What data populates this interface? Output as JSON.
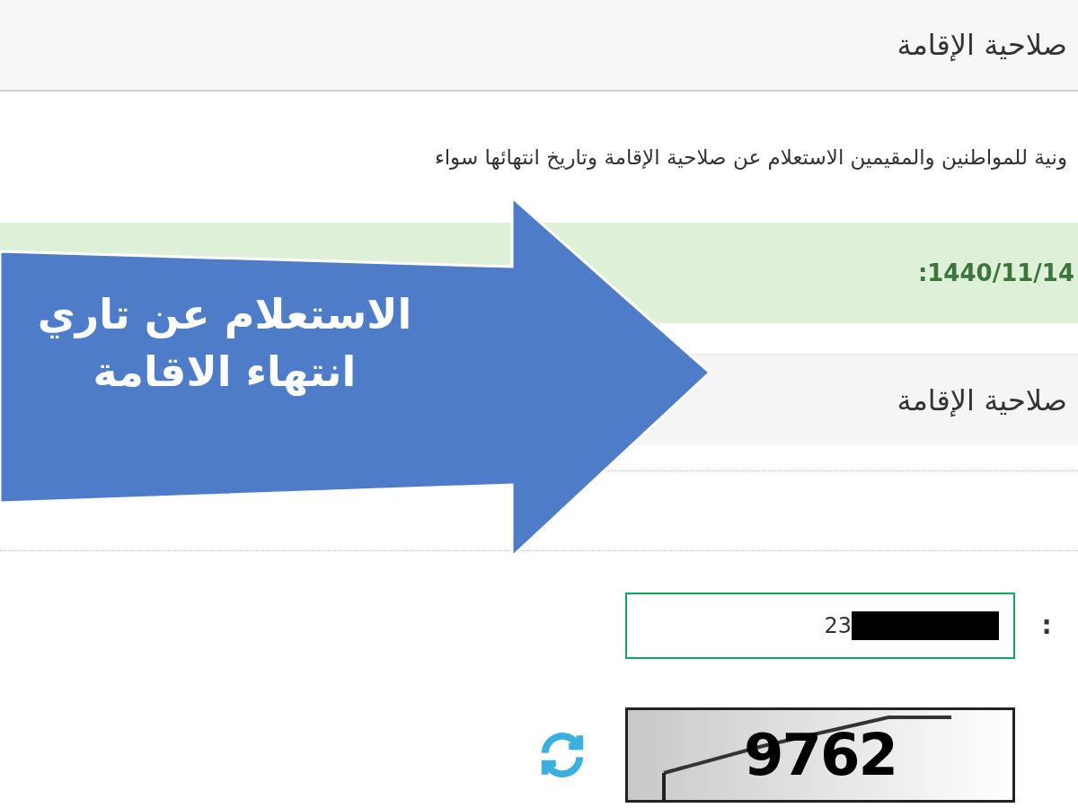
{
  "header": {
    "title": "صلاحية الإقامة"
  },
  "intro": "ونية للمواطنين والمقيمين الاستعلام عن صلاحية الإقامة وتاريخ انتهائها سواء",
  "alert": {
    "text": "1440/11/14:"
  },
  "panel": {
    "title": "صلاحية الإقامة"
  },
  "form": {
    "id_field": {
      "label": ":",
      "value": "23",
      "redacted": true
    },
    "captcha": {
      "code": "9762"
    }
  },
  "callout": {
    "lines": [
      "الاستعلام عن تاري",
      "انتهاء الاقامة"
    ]
  }
}
